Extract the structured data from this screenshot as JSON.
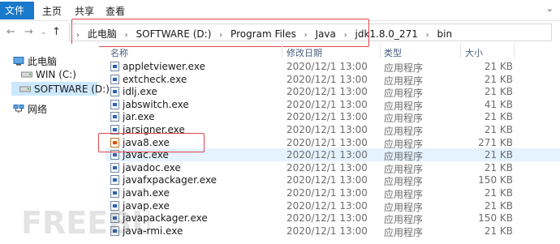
{
  "ribbon": {
    "file_tab": "文件",
    "tabs": [
      "主页",
      "共享",
      "查看"
    ]
  },
  "address": {
    "crumbs": [
      "此电脑",
      "SOFTWARE (D:)",
      "Program Files",
      "Java",
      "jdk1.8.0_271",
      "bin"
    ]
  },
  "nav_pane": {
    "items": [
      {
        "label": "此电脑",
        "icon": "computer-icon"
      },
      {
        "label": "WIN (C:)",
        "icon": "drive-icon"
      },
      {
        "label": "SOFTWARE (D:)",
        "icon": "drive-icon",
        "selected": true
      },
      {
        "label": "网络",
        "icon": "network-icon"
      }
    ]
  },
  "columns": {
    "name": "名称",
    "date": "修改日期",
    "type": "类型",
    "size": "大小"
  },
  "files": [
    {
      "name": "appletviewer.exe",
      "date": "2020/12/1 13:00",
      "type": "应用程序",
      "size": "21 KB"
    },
    {
      "name": "extcheck.exe",
      "date": "2020/12/1 13:00",
      "type": "应用程序",
      "size": "21 KB"
    },
    {
      "name": "idlj.exe",
      "date": "2020/12/1 13:00",
      "type": "应用程序",
      "size": "21 KB"
    },
    {
      "name": "jabswitch.exe",
      "date": "2020/12/1 13:00",
      "type": "应用程序",
      "size": "41 KB"
    },
    {
      "name": "jar.exe",
      "date": "2020/12/1 13:00",
      "type": "应用程序",
      "size": "21 KB"
    },
    {
      "name": "jarsigner.exe",
      "date": "2020/12/1 13:00",
      "type": "应用程序",
      "size": "21 KB"
    },
    {
      "name": "java8.exe",
      "date": "2020/12/1 13:00",
      "type": "应用程序",
      "size": "271 KB"
    },
    {
      "name": "javac.exe",
      "date": "2020/12/1 13:00",
      "type": "应用程序",
      "size": "21 KB"
    },
    {
      "name": "javadoc.exe",
      "date": "2020/12/1 13:00",
      "type": "应用程序",
      "size": "21 KB"
    },
    {
      "name": "javafxpackager.exe",
      "date": "2020/12/1 13:00",
      "type": "应用程序",
      "size": "150 KB"
    },
    {
      "name": "javah.exe",
      "date": "2020/12/1 13:00",
      "type": "应用程序",
      "size": "21 KB"
    },
    {
      "name": "javap.exe",
      "date": "2020/12/1 13:00",
      "type": "应用程序",
      "size": "21 KB"
    },
    {
      "name": "javapackager.exe",
      "date": "2020/12/1 13:00",
      "type": "应用程序",
      "size": "150 KB"
    },
    {
      "name": "java-rmi.exe",
      "date": "2020/12/1 13:00",
      "type": "应用程序",
      "size": "21 KB"
    }
  ],
  "watermark": "FREEBUF"
}
